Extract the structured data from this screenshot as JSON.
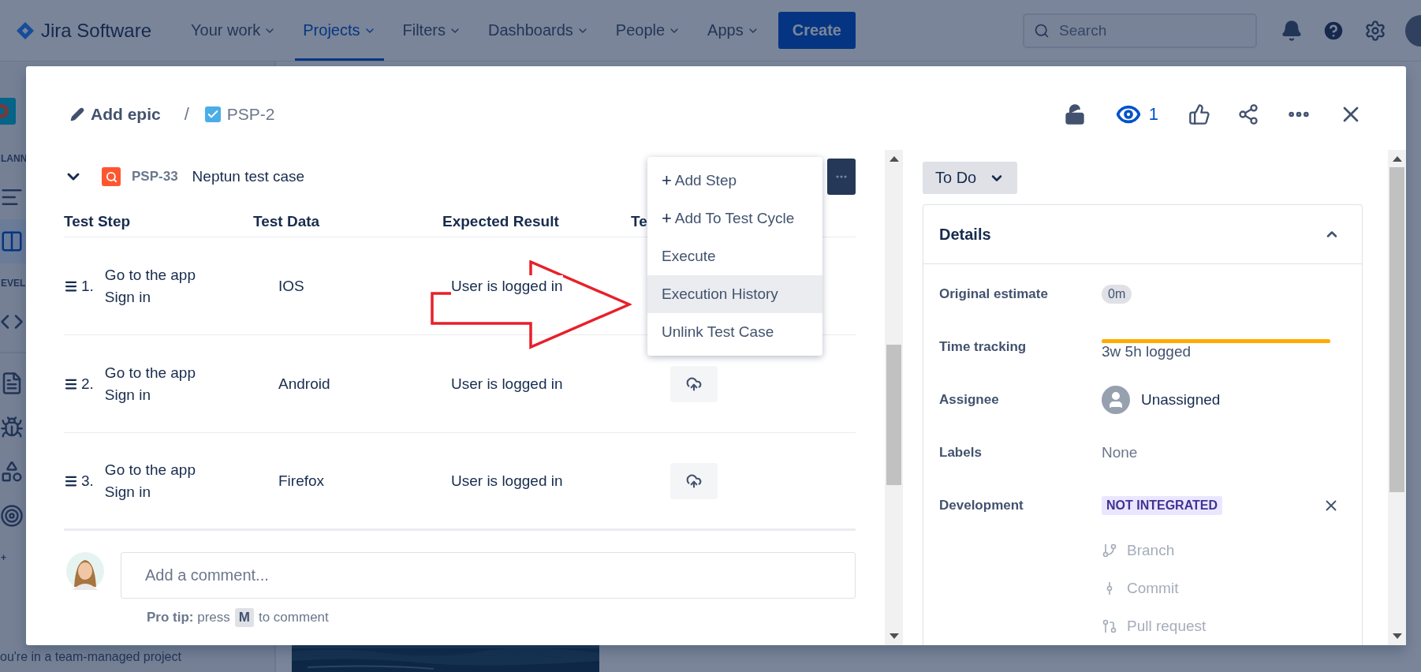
{
  "nav": {
    "product": "Jira Software",
    "items": [
      {
        "label": "Your work",
        "selected": false
      },
      {
        "label": "Projects",
        "selected": true
      },
      {
        "label": "Filters",
        "selected": false
      },
      {
        "label": "Dashboards",
        "selected": false
      },
      {
        "label": "People",
        "selected": false
      },
      {
        "label": "Apps",
        "selected": false
      }
    ],
    "create": "Create",
    "search": {
      "placeholder": "Search"
    }
  },
  "sidebar": {
    "items": [
      {
        "kind": "logo"
      },
      {
        "kind": "heading",
        "label": "LANN"
      },
      {
        "kind": "link",
        "selected": false
      },
      {
        "kind": "link",
        "selected": true
      },
      {
        "kind": "heading",
        "label": "EVEL"
      },
      {
        "kind": "link",
        "selected": false
      },
      {
        "kind": "divider"
      },
      {
        "kind": "link",
        "selected": false
      },
      {
        "kind": "link",
        "selected": false
      },
      {
        "kind": "link",
        "selected": false
      },
      {
        "kind": "link",
        "selected": false
      },
      {
        "kind": "heading",
        "label": "+"
      }
    ],
    "footer": "ou're in a team-managed project"
  },
  "issue": {
    "breadcrumb": {
      "epic": "Add epic",
      "separator": "/",
      "key": "PSP-2"
    },
    "watchers": "1",
    "test_case": {
      "key": "PSP-33",
      "title": "Neptun test case",
      "expanded": true
    },
    "table": {
      "columns": [
        "Test Step",
        "Test Data",
        "Expected Result",
        "Te"
      ],
      "rows": [
        {
          "number": "1.",
          "steps": [
            "Go to the app",
            "Sign in"
          ],
          "data": "IOS",
          "expected": "User is logged in",
          "upload_button": false
        },
        {
          "number": "2.",
          "steps": [
            "Go to the app",
            "Sign in"
          ],
          "data": "Android",
          "expected": "User is logged in",
          "upload_button": true
        },
        {
          "number": "3.",
          "steps": [
            "Go to the app",
            "Sign in"
          ],
          "data": "Firefox",
          "expected": "User is logged in",
          "upload_button": true
        }
      ]
    },
    "menu": {
      "items": [
        {
          "prefix": "+",
          "label": "Add Step",
          "selected": false
        },
        {
          "prefix": "+",
          "label": "Add To Test Cycle",
          "selected": false
        },
        {
          "label": "Execute",
          "selected": false
        },
        {
          "label": "Execution History",
          "selected": true
        },
        {
          "label": "Unlink Test Case",
          "selected": false
        }
      ]
    },
    "comment": {
      "placeholder": "Add a comment...",
      "tip": "**Pro tip:** press",
      "key": "M",
      "tip_end": "to comment"
    },
    "status": "To Do",
    "details": {
      "title": "Details",
      "expanded": true,
      "fields": [
        {
          "kind": "badge",
          "label": "Original estimate",
          "value": "0m"
        },
        {
          "kind": "progress",
          "label": "Time tracking",
          "level": 1,
          "value": "3w 5h logged"
        },
        {
          "kind": "user",
          "label": "Assignee",
          "value": "Unassigned"
        },
        {
          "kind": "text",
          "label": "Labels",
          "value": "None"
        },
        {
          "kind": "development",
          "label": "Development",
          "value": "NOT INTEGRATED",
          "links": [
            "Branch",
            "Commit",
            "Pull request"
          ]
        }
      ]
    }
  }
}
